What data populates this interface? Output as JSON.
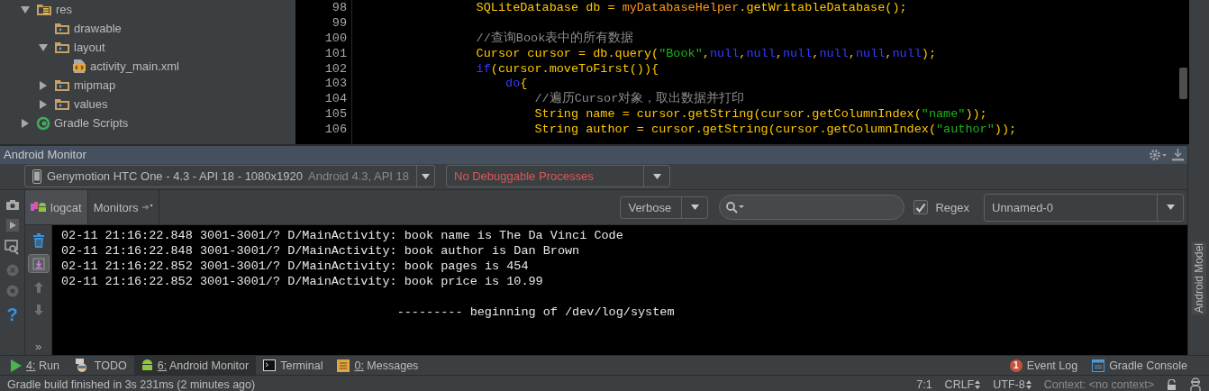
{
  "project_tree": [
    {
      "label": "res",
      "kind": "res-folder",
      "expanded": true,
      "children": [
        {
          "label": "drawable",
          "kind": "folder"
        },
        {
          "label": "layout",
          "kind": "folder",
          "expanded": true,
          "children": [
            {
              "label": "activity_main.xml",
              "kind": "xml"
            }
          ]
        },
        {
          "label": "mipmap",
          "kind": "folder",
          "expanded": false
        },
        {
          "label": "values",
          "kind": "folder",
          "expanded": false
        }
      ]
    },
    {
      "label": "Gradle Scripts",
      "kind": "gradle",
      "expanded": false
    }
  ],
  "editor": {
    "lines": [
      {
        "number": "98",
        "tokens": [
          {
            "kind": "plain",
            "text": "                SQLiteDatabase db = "
          },
          {
            "kind": "field",
            "text": "myDatabaseHelper"
          },
          {
            "kind": "plain",
            "text": ".getWritableDatabase();"
          }
        ]
      },
      {
        "number": "99"
      },
      {
        "number": "100",
        "tokens": [
          {
            "kind": "comment",
            "text": "                //查询Book表中的所有数据"
          }
        ]
      },
      {
        "number": "101",
        "tokens": [
          {
            "kind": "plain",
            "text": "                Cursor cursor = db.query("
          },
          {
            "kind": "string",
            "text": "\"Book\""
          },
          {
            "kind": "plain",
            "text": ","
          },
          {
            "kind": "keyword",
            "text": "null"
          },
          {
            "kind": "plain",
            "text": ","
          },
          {
            "kind": "keyword",
            "text": "null"
          },
          {
            "kind": "plain",
            "text": ","
          },
          {
            "kind": "keyword",
            "text": "null"
          },
          {
            "kind": "plain",
            "text": ","
          },
          {
            "kind": "keyword",
            "text": "null"
          },
          {
            "kind": "plain",
            "text": ","
          },
          {
            "kind": "keyword",
            "text": "null"
          },
          {
            "kind": "plain",
            "text": ","
          },
          {
            "kind": "keyword",
            "text": "null"
          },
          {
            "kind": "plain",
            "text": ");"
          }
        ]
      },
      {
        "number": "102",
        "tokens": [
          {
            "kind": "keyword",
            "text": "                if"
          },
          {
            "kind": "plain",
            "text": "(cursor.moveToFirst()){"
          }
        ]
      },
      {
        "number": "103",
        "tokens": [
          {
            "kind": "keyword",
            "text": "                    do"
          },
          {
            "kind": "plain",
            "text": "{"
          }
        ]
      },
      {
        "number": "104",
        "tokens": [
          {
            "kind": "comment",
            "text": "                        //遍历Cursor对象，取出数据并打印"
          }
        ]
      },
      {
        "number": "105",
        "tokens": [
          {
            "kind": "plain",
            "text": "                        String name = cursor.getString(cursor.getColumnIndex("
          },
          {
            "kind": "string",
            "text": "\"name\""
          },
          {
            "kind": "plain",
            "text": "));"
          }
        ]
      },
      {
        "number": "106",
        "tokens": [
          {
            "kind": "plain",
            "text": "                        String author = cursor.getString(cursor.getColumnIndex("
          },
          {
            "kind": "string",
            "text": "\"author\""
          },
          {
            "kind": "plain",
            "text": "));"
          }
        ]
      }
    ]
  },
  "android_monitor": {
    "title": "Android Monitor",
    "device": {
      "name": "Genymotion HTC One - 4.3 - API 18 - 1080x1920",
      "detail": "Android 4.3, API 18"
    },
    "process": "No Debuggable Processes",
    "side_tools": [
      {
        "kind": "camera",
        "disabled": false
      },
      {
        "kind": "play",
        "disabled": false
      },
      {
        "kind": "screen",
        "disabled": false
      },
      {
        "kind": "stop",
        "disabled": true
      },
      {
        "kind": "dump",
        "disabled": true
      },
      {
        "kind": "help",
        "glyph": "?",
        "disabled": false
      }
    ],
    "tabs": [
      {
        "label": "logcat",
        "kind": "logcat",
        "selected": true
      },
      {
        "label": "Monitors",
        "kind": "monitors",
        "selected": false
      }
    ],
    "log_level": "Verbose",
    "regex": {
      "label": "Regex",
      "checked": true
    },
    "filter": "Unnamed-0",
    "log_tools": [
      {
        "kind": "trash",
        "on": false
      },
      {
        "kind": "scroll-end",
        "on": true
      },
      {
        "kind": "up",
        "on": false
      },
      {
        "kind": "down",
        "on": false
      },
      {
        "kind": "more",
        "glyph": "»",
        "on": false
      }
    ],
    "log_lines": [
      {
        "kind": "entry",
        "text": "02-11 21:16:22.848 3001-3001/? D/MainActivity: book name is The Da Vinci Code"
      },
      {
        "kind": "entry",
        "text": "02-11 21:16:22.848 3001-3001/? D/MainActivity: book author is Dan Brown"
      },
      {
        "kind": "entry",
        "text": "02-11 21:16:22.852 3001-3001/? D/MainActivity: book pages is 454"
      },
      {
        "kind": "entry",
        "text": "02-11 21:16:22.852 3001-3001/? D/MainActivity: book price is 10.99"
      },
      {
        "kind": "separator",
        "text": "--------- beginning of /dev/log/system"
      }
    ],
    "side_label": "Android Model"
  },
  "tool_windows": {
    "left": [
      {
        "label": "4: Run",
        "kind": "run",
        "mnemonic": true,
        "selected": false
      },
      {
        "label": "TODO",
        "kind": "todo",
        "mnemonic": false,
        "selected": false
      },
      {
        "label": "6: Android Monitor",
        "kind": "android",
        "mnemonic": true,
        "selected": true
      },
      {
        "label": "Terminal",
        "kind": "terminal",
        "mnemonic": false,
        "selected": false
      },
      {
        "label": "0: Messages",
        "kind": "messages",
        "mnemonic": true,
        "selected": false
      }
    ],
    "right": [
      {
        "label": "Event Log",
        "kind": "event-log",
        "badge": "1",
        "mnemonic": false,
        "selected": false
      },
      {
        "label": "Gradle Console",
        "kind": "console",
        "mnemonic": false,
        "selected": false
      }
    ]
  },
  "status_bar": {
    "message": "Gradle build finished in 3s 231ms (2 minutes ago)",
    "position": "7:1",
    "line_separator": "CRLF",
    "encoding": "UTF-8",
    "context": "Context: <no context>"
  }
}
